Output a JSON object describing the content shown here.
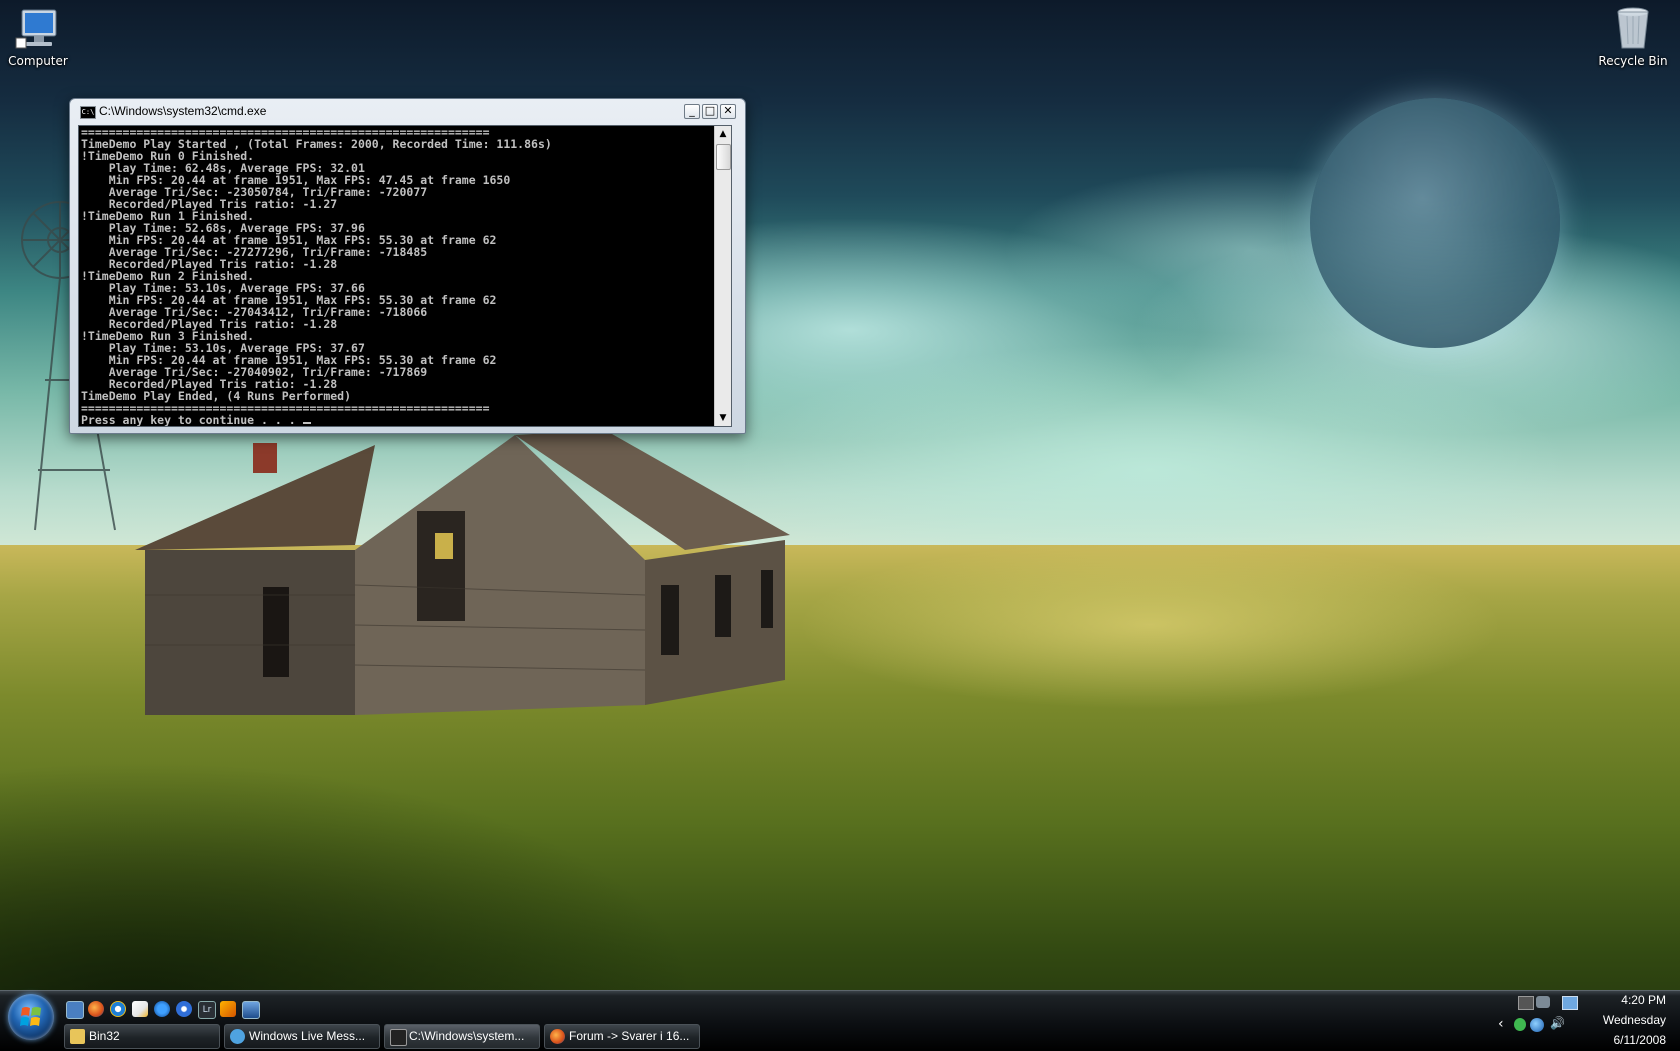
{
  "desktop": {
    "icons": [
      {
        "label": "Computer",
        "icon": "computer-icon"
      },
      {
        "label": "Recycle Bin",
        "icon": "recycle-bin-icon"
      }
    ]
  },
  "cmd_window": {
    "title": "C:\\Windows\\system32\\cmd.exe",
    "icon_text": "C:\\",
    "controls": {
      "minimize": "_",
      "maximize": "□",
      "close": "✕"
    },
    "lines": [
      "===========================================================",
      "TimeDemo Play Started , (Total Frames: 2000, Recorded Time: 111.86s)",
      "!TimeDemo Run 0 Finished.",
      "    Play Time: 62.48s, Average FPS: 32.01",
      "    Min FPS: 20.44 at frame 1951, Max FPS: 47.45 at frame 1650",
      "    Average Tri/Sec: -23050784, Tri/Frame: -720077",
      "    Recorded/Played Tris ratio: -1.27",
      "!TimeDemo Run 1 Finished.",
      "    Play Time: 52.68s, Average FPS: 37.96",
      "    Min FPS: 20.44 at frame 1951, Max FPS: 55.30 at frame 62",
      "    Average Tri/Sec: -27277296, Tri/Frame: -718485",
      "    Recorded/Played Tris ratio: -1.28",
      "!TimeDemo Run 2 Finished.",
      "    Play Time: 53.10s, Average FPS: 37.66",
      "    Min FPS: 20.44 at frame 1951, Max FPS: 55.30 at frame 62",
      "    Average Tri/Sec: -27043412, Tri/Frame: -718066",
      "    Recorded/Played Tris ratio: -1.28",
      "!TimeDemo Run 3 Finished.",
      "    Play Time: 53.10s, Average FPS: 37.67",
      "    Min FPS: 20.44 at frame 1951, Max FPS: 55.30 at frame 62",
      "    Average Tri/Sec: -27040902, Tri/Frame: -717869",
      "    Recorded/Played Tris ratio: -1.28",
      "TimeDemo Play Ended, (4 Runs Performed)",
      "===========================================================",
      "Press any key to continue . . . "
    ],
    "scroll_up": "▲",
    "scroll_down": "▼"
  },
  "taskbar": {
    "quick_launch": [
      "show-desktop-icon",
      "firefox-icon",
      "internet-explorer-icon",
      "notepad-icon",
      "messenger-icon",
      "blue-app-icon",
      "lightroom-icon",
      "winamp-icon",
      "window-switcher-icon"
    ],
    "quick_launch_texts": {
      "lightroom": "Lr"
    },
    "buttons": [
      {
        "label": "Bin32",
        "icon": "folder-icon",
        "color": "#e8c55a",
        "active": false
      },
      {
        "label": "Windows Live Mess...",
        "icon": "messenger-icon",
        "color": "#4fa3e0",
        "active": false
      },
      {
        "label": "C:\\Windows\\system...",
        "icon": "cmd-icon",
        "color": "#222222",
        "active": true
      },
      {
        "label": "Forum -> Svarer i 16...",
        "icon": "firefox-icon",
        "color": "#e66a1a",
        "active": false
      }
    ],
    "tray": {
      "show_hidden": "‹",
      "volume": "🔊",
      "time": "4:20 PM",
      "day": "Wednesday",
      "date": "6/11/2008"
    }
  },
  "colors": {
    "console_text": "#c0c0c0",
    "console_bg": "#000000",
    "taskbar": "#0c0f12"
  }
}
